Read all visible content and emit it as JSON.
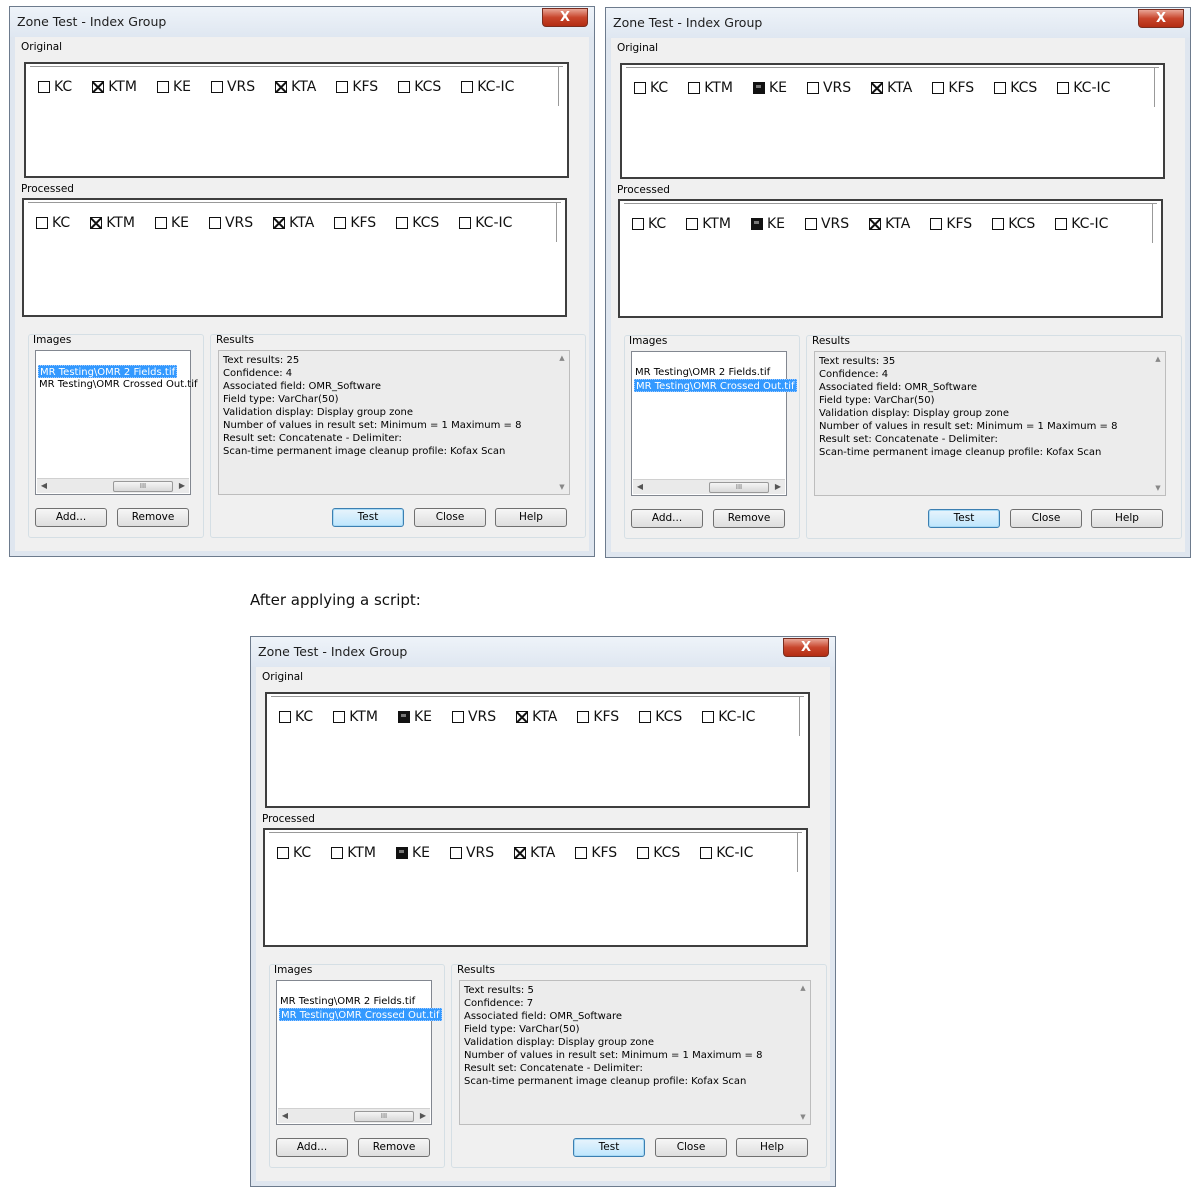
{
  "caption": "After applying a script:",
  "dialogs": [
    {
      "title": "Zone Test - Index Group",
      "close_glyph": "X",
      "original_label": "Original",
      "processed_label": "Processed",
      "images_label": "Images",
      "results_label": "Results",
      "original": [
        {
          "label": "KC",
          "state": "empty"
        },
        {
          "label": "KTM",
          "state": "x"
        },
        {
          "label": "KE",
          "state": "empty"
        },
        {
          "label": "VRS",
          "state": "empty"
        },
        {
          "label": "KTA",
          "state": "x"
        },
        {
          "label": "KFS",
          "state": "empty"
        },
        {
          "label": "KCS",
          "state": "empty"
        },
        {
          "label": "KC-IC",
          "state": "empty"
        }
      ],
      "processed": [
        {
          "label": "KC",
          "state": "empty"
        },
        {
          "label": "KTM",
          "state": "x"
        },
        {
          "label": "KE",
          "state": "empty"
        },
        {
          "label": "VRS",
          "state": "empty"
        },
        {
          "label": "KTA",
          "state": "x"
        },
        {
          "label": "KFS",
          "state": "empty"
        },
        {
          "label": "KCS",
          "state": "empty"
        },
        {
          "label": "KC-IC",
          "state": "empty"
        }
      ],
      "images": [
        {
          "name": "MR Testing\\OMR 2 Fields.tif",
          "selected": true
        },
        {
          "name": "MR Testing\\OMR Crossed Out.tif",
          "selected": false
        }
      ],
      "results": [
        "Text results: 25",
        "Confidence: 4",
        "Associated field: OMR_Software",
        "Field type: VarChar(50)",
        "Validation display: Display group zone",
        "Number of values in result set: Minimum = 1 Maximum = 8",
        "Result set: Concatenate - Delimiter:",
        "Scan-time permanent image cleanup profile: Kofax Scan"
      ],
      "buttons": {
        "add": "Add...",
        "remove": "Remove",
        "test": "Test",
        "close": "Close",
        "help": "Help"
      }
    },
    {
      "title": "Zone Test - Index Group",
      "close_glyph": "X",
      "original_label": "Original",
      "processed_label": "Processed",
      "images_label": "Images",
      "results_label": "Results",
      "original": [
        {
          "label": "KC",
          "state": "empty"
        },
        {
          "label": "KTM",
          "state": "empty"
        },
        {
          "label": "KE",
          "state": "filled"
        },
        {
          "label": "VRS",
          "state": "empty"
        },
        {
          "label": "KTA",
          "state": "x"
        },
        {
          "label": "KFS",
          "state": "empty"
        },
        {
          "label": "KCS",
          "state": "empty"
        },
        {
          "label": "KC-IC",
          "state": "empty"
        }
      ],
      "processed": [
        {
          "label": "KC",
          "state": "empty"
        },
        {
          "label": "KTM",
          "state": "empty"
        },
        {
          "label": "KE",
          "state": "filled"
        },
        {
          "label": "VRS",
          "state": "empty"
        },
        {
          "label": "KTA",
          "state": "x"
        },
        {
          "label": "KFS",
          "state": "empty"
        },
        {
          "label": "KCS",
          "state": "empty"
        },
        {
          "label": "KC-IC",
          "state": "empty"
        }
      ],
      "images": [
        {
          "name": "MR Testing\\OMR 2 Fields.tif",
          "selected": false
        },
        {
          "name": "MR Testing\\OMR Crossed Out.tif",
          "selected": true
        }
      ],
      "results": [
        "Text results: 35",
        "Confidence: 4",
        "Associated field: OMR_Software",
        "Field type: VarChar(50)",
        "Validation display: Display group zone",
        "Number of values in result set: Minimum = 1 Maximum = 8",
        "Result set: Concatenate - Delimiter:",
        "Scan-time permanent image cleanup profile: Kofax Scan"
      ],
      "buttons": {
        "add": "Add...",
        "remove": "Remove",
        "test": "Test",
        "close": "Close",
        "help": "Help"
      }
    },
    {
      "title": "Zone Test - Index Group",
      "close_glyph": "X",
      "original_label": "Original",
      "processed_label": "Processed",
      "images_label": "Images",
      "results_label": "Results",
      "original": [
        {
          "label": "KC",
          "state": "empty"
        },
        {
          "label": "KTM",
          "state": "empty"
        },
        {
          "label": "KE",
          "state": "filled"
        },
        {
          "label": "VRS",
          "state": "empty"
        },
        {
          "label": "KTA",
          "state": "x"
        },
        {
          "label": "KFS",
          "state": "empty"
        },
        {
          "label": "KCS",
          "state": "empty"
        },
        {
          "label": "KC-IC",
          "state": "empty"
        }
      ],
      "processed": [
        {
          "label": "KC",
          "state": "empty"
        },
        {
          "label": "KTM",
          "state": "empty"
        },
        {
          "label": "KE",
          "state": "filled"
        },
        {
          "label": "VRS",
          "state": "empty"
        },
        {
          "label": "KTA",
          "state": "x"
        },
        {
          "label": "KFS",
          "state": "empty"
        },
        {
          "label": "KCS",
          "state": "empty"
        },
        {
          "label": "KC-IC",
          "state": "empty"
        }
      ],
      "images": [
        {
          "name": "MR Testing\\OMR 2 Fields.tif",
          "selected": false
        },
        {
          "name": "MR Testing\\OMR Crossed Out.tif",
          "selected": true
        }
      ],
      "results": [
        "Text results: 5",
        "Confidence: 7",
        "Associated field: OMR_Software",
        "Field type: VarChar(50)",
        "Validation display: Display group zone",
        "Number of values in result set: Minimum = 1 Maximum = 8",
        "Result set: Concatenate - Delimiter:",
        "Scan-time permanent image cleanup profile: Kofax Scan"
      ],
      "buttons": {
        "add": "Add...",
        "remove": "Remove",
        "test": "Test",
        "close": "Close",
        "help": "Help"
      }
    }
  ]
}
